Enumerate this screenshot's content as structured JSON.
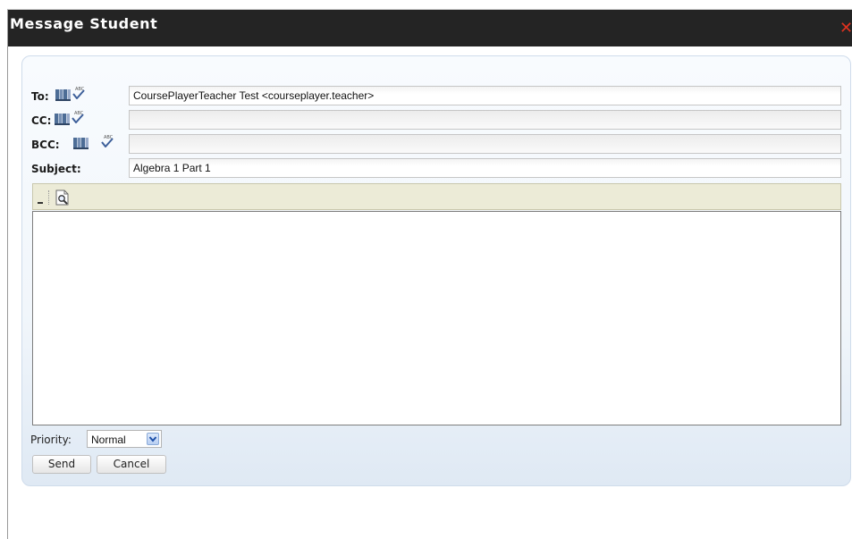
{
  "dialog": {
    "title": "Message Student",
    "close_glyph": "✕"
  },
  "fields": {
    "to": {
      "label": "To:",
      "value": "CoursePlayerTeacher Test <courseplayer.teacher>"
    },
    "cc": {
      "label": "CC:",
      "value": ""
    },
    "bcc": {
      "label": "BCC:",
      "value": ""
    },
    "subject": {
      "label": "Subject:",
      "value": "Algebra 1 Part 1"
    }
  },
  "icons": {
    "address_book": "address-book-icon",
    "spell_check": "spell-check-icon",
    "preview": "preview-icon"
  },
  "editor": {
    "content": ""
  },
  "priority": {
    "label": "Priority:",
    "selected": "Normal"
  },
  "buttons": {
    "send": "Send",
    "cancel": "Cancel"
  },
  "colors": {
    "titlebar": "#242424",
    "close": "#e0321f",
    "toolbar": "#ecebd7",
    "panel": "#f1f6fb"
  }
}
